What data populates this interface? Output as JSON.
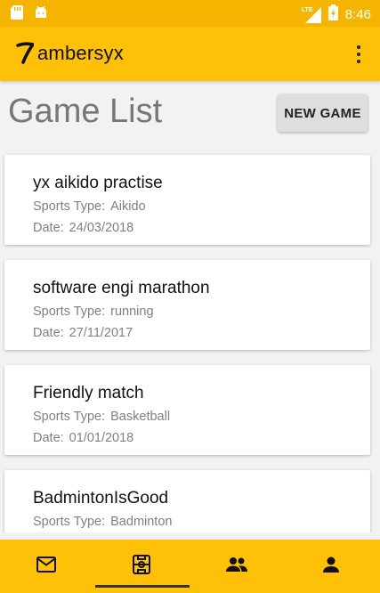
{
  "status_bar": {
    "time": "8:46",
    "network": "LTE",
    "icons": [
      "sd-card-icon",
      "android-icon",
      "signal-icon",
      "battery-charging-icon"
    ]
  },
  "app_bar": {
    "title": "ambersyx",
    "logo_icon": "seven-logo-icon",
    "menu_icon": "overflow-menu-icon"
  },
  "page": {
    "title": "Game List",
    "new_game_label": "NEW GAME"
  },
  "labels": {
    "sports_type": "Sports Type:",
    "date": "Date:"
  },
  "games": [
    {
      "name": "yx aikido practise",
      "sports_type": "Aikido",
      "date": "24/03/2018"
    },
    {
      "name": "software engi marathon",
      "sports_type": "running",
      "date": "27/11/2017"
    },
    {
      "name": "Friendly match",
      "sports_type": "Basketball",
      "date": "01/01/2018"
    },
    {
      "name": "BadmintonIsGood",
      "sports_type": "Badminton",
      "date": ""
    }
  ],
  "bottom_nav": {
    "items": [
      "mail-icon",
      "scoreboard-icon",
      "group-icon",
      "person-icon"
    ],
    "selected_index": 1
  },
  "colors": {
    "primary": "#ffc107",
    "status_bar": "#f5b400",
    "background": "#f2f2f2"
  }
}
